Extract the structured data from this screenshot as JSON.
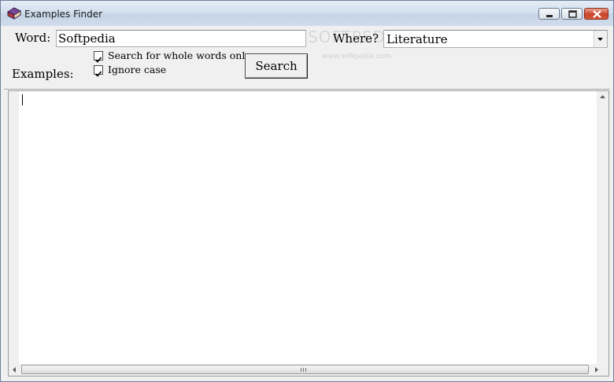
{
  "window": {
    "title": "Examples Finder",
    "icon": "book-icon",
    "controls": [
      "minimize-icon",
      "maximize-icon",
      "close-icon"
    ]
  },
  "form": {
    "word_label": "Word:",
    "word_value": "Softpedia",
    "where_label": "Where?",
    "where_value": "Literature",
    "examples_label": "Examples:",
    "options": [
      {
        "label": "Search for whole words only",
        "checked": true
      },
      {
        "label": "Ignore case",
        "checked": true
      }
    ],
    "search_button": "Search"
  },
  "watermark": {
    "main": "SOFTPEDIA",
    "url": "www.softpedia.com"
  },
  "results": {
    "text": ""
  },
  "colors": {
    "titlebar": "#d4e0ee",
    "close_button": "#c9432a"
  }
}
